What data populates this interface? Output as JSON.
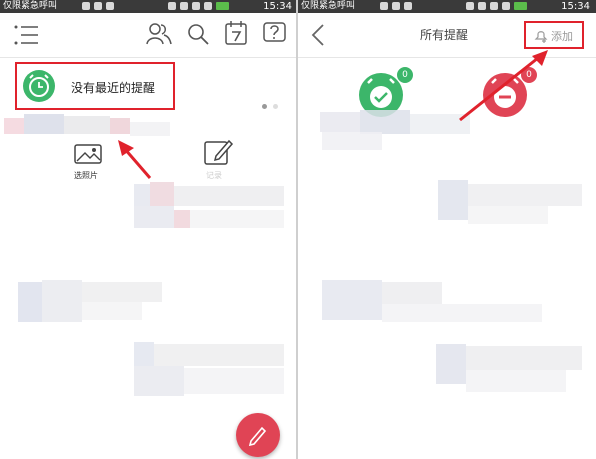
{
  "left_screen": {
    "status_bar": {
      "carrier": "仅限紧急呼叫",
      "time": "15:34"
    },
    "reminder_card": {
      "label": "没有最近的提醒"
    },
    "shortcuts": [
      {
        "label": "选照片"
      },
      {
        "label": "记录"
      }
    ]
  },
  "right_screen": {
    "status_bar": {
      "carrier": "仅限紧急呼叫",
      "time": "15:34"
    },
    "header": {
      "title": "所有提醒",
      "add_label": "添加"
    },
    "badges": {
      "active_count": "0",
      "inactive_count": "0"
    }
  },
  "colors": {
    "highlight_red": "#e0222c",
    "green": "#3cb66a",
    "pink": "#e04455",
    "status_bar": "#3a3a3a"
  }
}
